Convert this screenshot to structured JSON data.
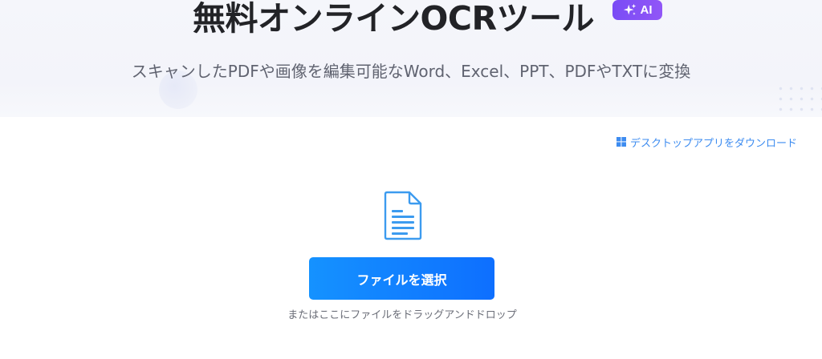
{
  "hero": {
    "title": "無料オンラインOCRツール",
    "badge_label": "AI",
    "subtitle": "スキャンしたPDFや画像を編集可能なWord、Excel、PPT、PDFやTXTに変換"
  },
  "desktop_link": {
    "label": "デスクトップアプリをダウンロード",
    "icon": "windows-icon"
  },
  "upload": {
    "file_icon": "document-icon",
    "button_label": "ファイルを選択",
    "drop_hint": "またはここにファイルをドラッグアンドドロップ"
  },
  "colors": {
    "accent": "#1a7dff",
    "badge": "#8a52f6",
    "link": "#3d8cf0",
    "title": "#222327"
  }
}
